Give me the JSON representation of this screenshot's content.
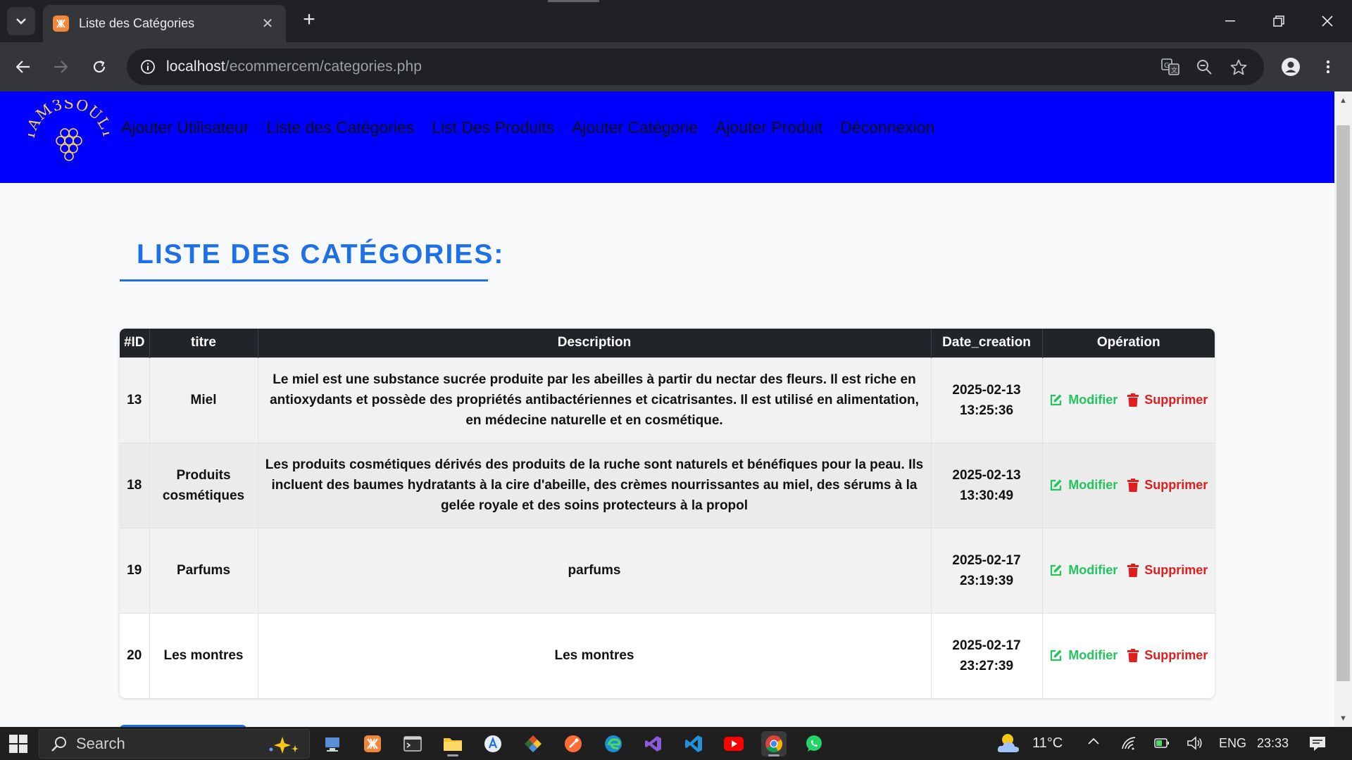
{
  "browser": {
    "tab_title": "Liste des Catégories",
    "url_host": "localhost",
    "url_path": "/ecommercem/categories.php"
  },
  "navbar": {
    "logo_text": "TAM3SOULT",
    "links": [
      {
        "label": "Ajouter Utilisateur"
      },
      {
        "label": "Liste des Catégories"
      },
      {
        "label": "List Des Produits"
      },
      {
        "label": "Ajouter Catégorie"
      },
      {
        "label": "Ajouter Produit"
      },
      {
        "label": "Déconnexion"
      }
    ]
  },
  "page": {
    "title": "LISTE DES CATÉGORIES:"
  },
  "table": {
    "headers": [
      "#ID",
      "titre",
      "Description",
      "Date_creation",
      "Opération"
    ],
    "rows": [
      {
        "id": "13",
        "titre": "Miel",
        "description": "Le miel est une substance sucrée produite par les abeilles à partir du nectar des fleurs. Il est riche en antioxydants et possède des propriétés antibactériennes et cicatrisantes. Il est utilisé en alimentation, en médecine naturelle et en cosmétique.",
        "date": "2025-02-13",
        "time": "13:25:36"
      },
      {
        "id": "18",
        "titre": "Produits cosmétiques",
        "description": "Les produits cosmétiques dérivés des produits de la ruche sont naturels et bénéfiques pour la peau. Ils incluent des baumes hydratants à la cire d'abeille, des crèmes nourrissantes au miel, des sérums à la gelée royale et des soins protecteurs à la propol",
        "date": "2025-02-13",
        "time": "13:30:49"
      },
      {
        "id": "19",
        "titre": "Parfums",
        "description": "parfums",
        "date": "2025-02-17",
        "time": "23:19:39"
      },
      {
        "id": "20",
        "titre": "Les montres",
        "description": "Les montres",
        "date": "2025-02-17",
        "time": "23:27:39"
      }
    ],
    "edit_label": "Modifier",
    "delete_label": "Supprimer"
  },
  "taskbar": {
    "search_placeholder": "Search",
    "temperature": "11°C",
    "language": "ENG",
    "clock": "23:33"
  },
  "colors": {
    "navbar": "#0000ff",
    "title": "#1e70e6",
    "table_header": "#212529",
    "edit": "#22c55e",
    "delete": "#e11d1d"
  }
}
